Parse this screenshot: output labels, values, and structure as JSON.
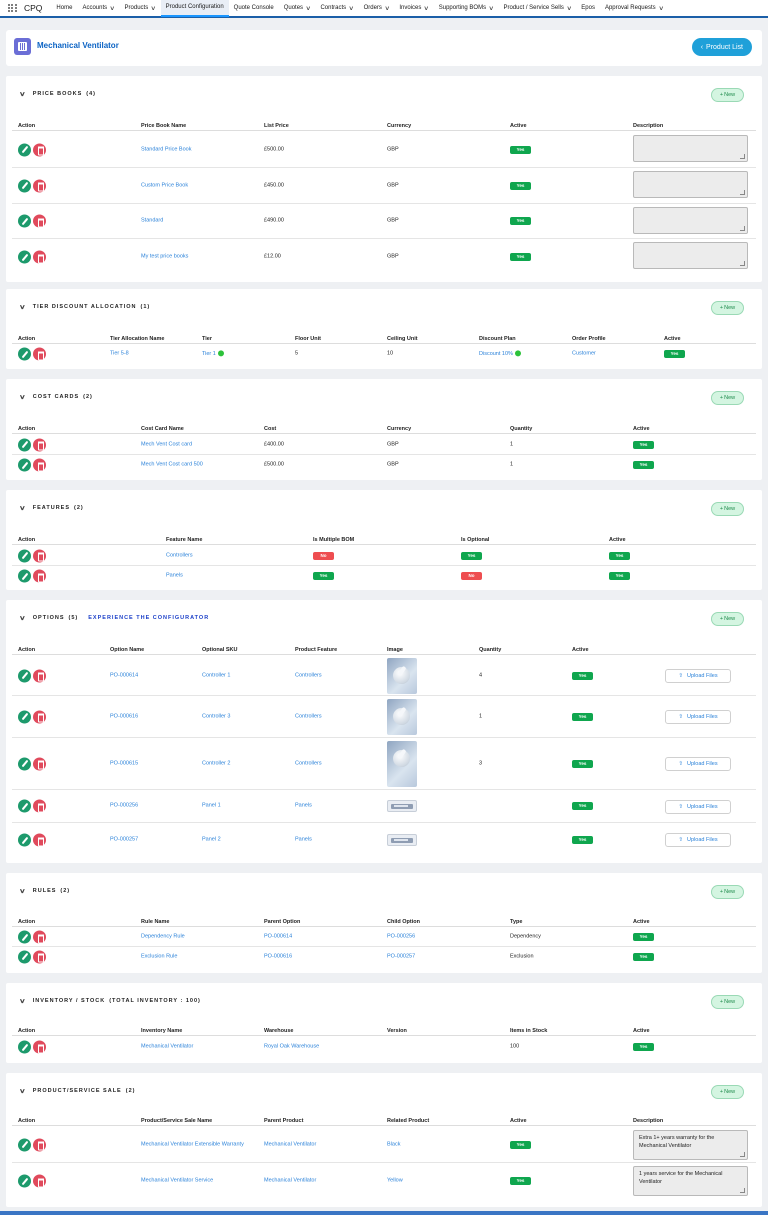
{
  "nav": {
    "app": "CPQ",
    "items": [
      "Home",
      "Accounts",
      "Products",
      "Product Configuration",
      "Quote Console",
      "Quotes",
      "Contracts",
      "Orders",
      "Invoices",
      "Supporting BOMs",
      "Product / Service Sells",
      "Epos",
      "Approval Requests"
    ]
  },
  "header": {
    "title": "Mechanical Ventilator",
    "product_list": "Product List"
  },
  "new_label": "New",
  "upload_label": "Upload Files",
  "price_books": {
    "title": "PRICE BOOKS",
    "count": "(4)",
    "cols": [
      "Action",
      "Price Book Name",
      "List Price",
      "Currency",
      "Active",
      "Description"
    ],
    "rows": [
      {
        "name": "Standard Price Book",
        "price": "£500.00",
        "currency": "GBP",
        "active": "Yes"
      },
      {
        "name": "Custom Price Book",
        "price": "£450.00",
        "currency": "GBP",
        "active": "Yes"
      },
      {
        "name": "Standard",
        "price": "£490.00",
        "currency": "GBP",
        "active": "Yes"
      },
      {
        "name": "My test price books",
        "price": "£12.00",
        "currency": "GBP",
        "active": "Yes"
      }
    ]
  },
  "tier": {
    "title": "TIER DISCOUNT ALLOCATION",
    "count": "(1)",
    "cols": [
      "Action",
      "Tier Allocation Name",
      "Tier",
      "Floor Unit",
      "Ceiling Unit",
      "Discount Plan",
      "Order Profile",
      "Active"
    ],
    "rows": [
      {
        "name": "Tier 5-8",
        "tier": "Tier 1",
        "floor": "5",
        "ceiling": "10",
        "plan": "Discount 10%",
        "profile": "Customer",
        "active": "Yes"
      }
    ]
  },
  "cost_cards": {
    "title": "COST CARDS",
    "count": "(2)",
    "cols": [
      "Action",
      "Cost Card Name",
      "Cost",
      "Currency",
      "Quantity",
      "Active"
    ],
    "rows": [
      {
        "name": "Mech Vent Cost card",
        "cost": "£400.00",
        "currency": "GBP",
        "qty": "1",
        "active": "Yes"
      },
      {
        "name": "Mech Vent Cost card 500",
        "cost": "£500.00",
        "currency": "GBP",
        "qty": "1",
        "active": "Yes"
      }
    ]
  },
  "features": {
    "title": "FEATURES",
    "count": "(2)",
    "cols": [
      "Action",
      "Feature Name",
      "Is Multiple BOM",
      "Is Optional",
      "Active"
    ],
    "rows": [
      {
        "name": "Controllers",
        "multi": "No",
        "optional": "Yes",
        "active": "Yes"
      },
      {
        "name": "Panels",
        "multi": "Yes",
        "optional": "No",
        "active": "Yes"
      }
    ]
  },
  "options": {
    "title": "OPTIONS",
    "count": "(5)",
    "configurator": "EXPERIENCE THE CONFIGURATOR",
    "cols": [
      "Action",
      "Option Name",
      "Optional SKU",
      "Product Feature",
      "Image",
      "Quantity",
      "Active"
    ],
    "rows": [
      {
        "name": "PO-000614",
        "sku": "Controller 1",
        "feature": "Controllers",
        "qty": "4",
        "active": "Yes",
        "image": "controller-knob"
      },
      {
        "name": "PO-000616",
        "sku": "Controller 3",
        "feature": "Controllers",
        "qty": "1",
        "active": "Yes",
        "image": "controller-knob"
      },
      {
        "name": "PO-000615",
        "sku": "Controller 2",
        "feature": "Controllers",
        "qty": "3",
        "active": "Yes",
        "image": "controller-knob"
      },
      {
        "name": "PO-000256",
        "sku": "Panel 1",
        "feature": "Panels",
        "qty": "",
        "active": "Yes",
        "image": "panel"
      },
      {
        "name": "PO-000257",
        "sku": "Panel 2",
        "feature": "Panels",
        "qty": "",
        "active": "Yes",
        "image": "panel"
      }
    ]
  },
  "rules": {
    "title": "RULES",
    "count": "(2)",
    "cols": [
      "Action",
      "Rule Name",
      "Parent Option",
      "Child Option",
      "Type",
      "Active"
    ],
    "rows": [
      {
        "name": "Dependency Rule",
        "parent": "PO-000614",
        "child": "PO-000256",
        "type": "Dependency",
        "active": "Yes"
      },
      {
        "name": "Exclusion Rule",
        "parent": "PO-000616",
        "child": "PO-000257",
        "type": "Exclusion",
        "active": "Yes"
      }
    ]
  },
  "inventory": {
    "title": "INVENTORY / STOCK",
    "count": "(TOTAL INVENTORY : 100)",
    "cols": [
      "Action",
      "Inventory Name",
      "Warehouse",
      "Version",
      "Items in Stock",
      "Active"
    ],
    "rows": [
      {
        "name": "Mechanical Ventilator",
        "warehouse": "Royal Oak Warehouse",
        "version": "",
        "stock": "100",
        "active": "Yes"
      }
    ]
  },
  "sales": {
    "title": "PRODUCT/SERVICE SALE",
    "count": "(2)",
    "cols": [
      "Action",
      "Product/Service Sale Name",
      "Parent Product",
      "Related Product",
      "Active",
      "Description"
    ],
    "rows": [
      {
        "name": "Mechanical Ventilator Extensible Warranty",
        "parent": "Mechanical Ventilator",
        "related": "Black",
        "active": "Yes",
        "desc": "Extra 1+ years warranty for the Mechanical Ventilator"
      },
      {
        "name": "Mechanical Ventilator Service",
        "parent": "Mechanical Ventilator",
        "related": "Yellow",
        "active": "Yes",
        "desc": "1 years service for the Mechanical Ventilator"
      }
    ]
  },
  "colors": {
    "accent": "#1fa0d9",
    "link": "#2b82d9",
    "yes": "#0fa64e",
    "no": "#ee4d50",
    "nav_border": "#1b5fa8"
  }
}
